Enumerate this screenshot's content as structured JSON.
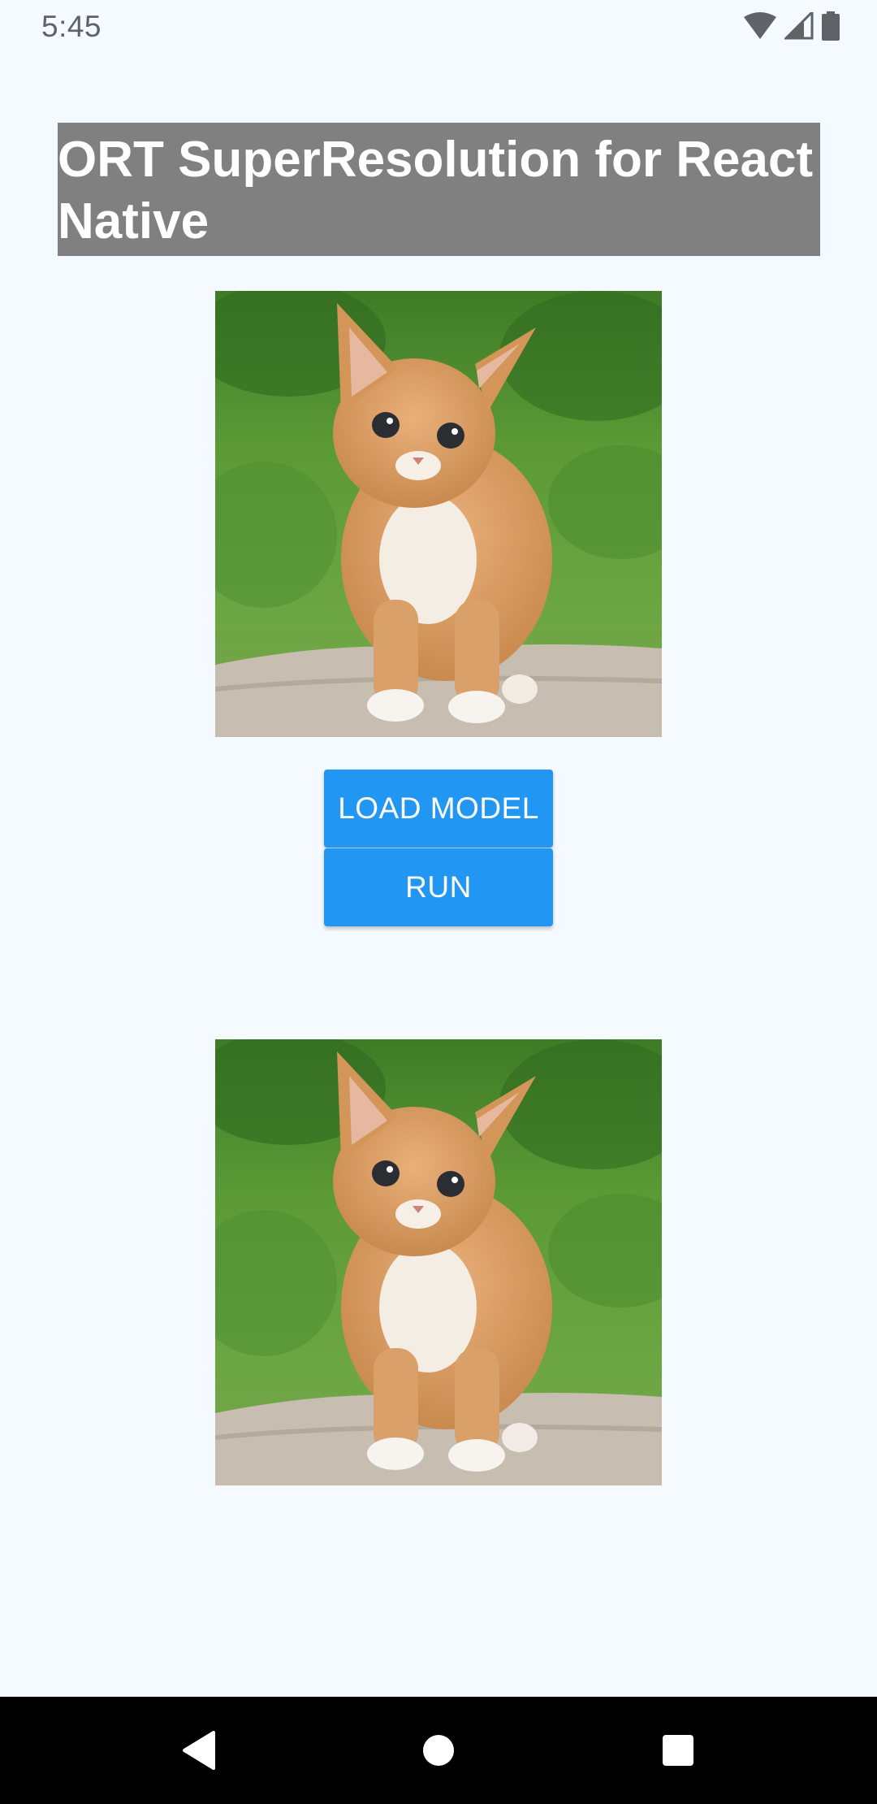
{
  "status_bar": {
    "time": "5:45",
    "icons": [
      "wifi-icon",
      "signal-icon",
      "battery-icon"
    ]
  },
  "app": {
    "title": "ORT SuperResolution for React Native",
    "input_image": {
      "subject": "orange kitten on grass"
    },
    "output_image": {
      "subject": "orange kitten on grass"
    },
    "buttons": {
      "load_model": "LOAD MODEL",
      "run": "RUN"
    }
  },
  "nav_bar": {
    "items": [
      "back-icon",
      "home-icon",
      "recents-icon"
    ]
  },
  "colors": {
    "background": "#f4faff",
    "title_bar": "#808080",
    "title_text": "#ffffff",
    "button": "#2196f3",
    "button_text": "#ffffff",
    "nav_bar": "#000000"
  }
}
